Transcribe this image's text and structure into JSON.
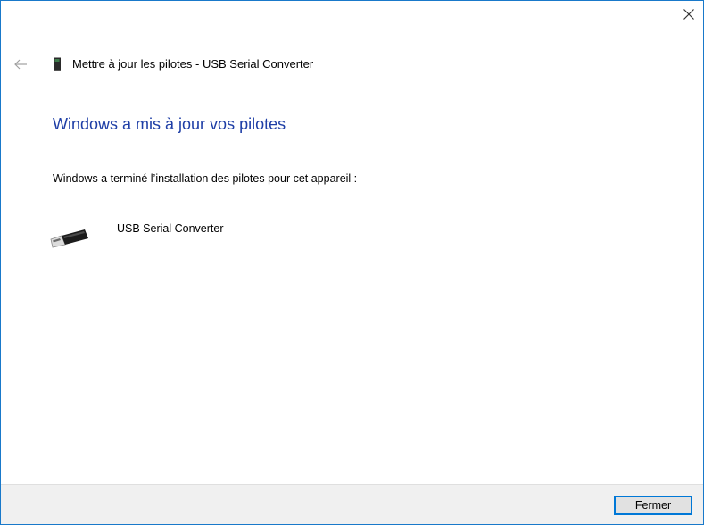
{
  "window": {
    "title": "Mettre à jour les pilotes - USB Serial Converter",
    "close_icon": "close-icon",
    "back_icon": "arrow-left-icon",
    "title_icon": "driver-device-icon"
  },
  "main": {
    "heading": "Windows a mis à jour vos pilotes",
    "info": "Windows a terminé l’installation des pilotes pour cet appareil :",
    "device": {
      "name": "USB Serial Converter",
      "icon": "usb-plug-icon"
    }
  },
  "footer": {
    "close_label": "Fermer"
  },
  "colors": {
    "accent": "#0078d7",
    "heading": "#1e3ea6",
    "footer_bg": "#f0f0f0",
    "window_border": "#1979ca"
  }
}
